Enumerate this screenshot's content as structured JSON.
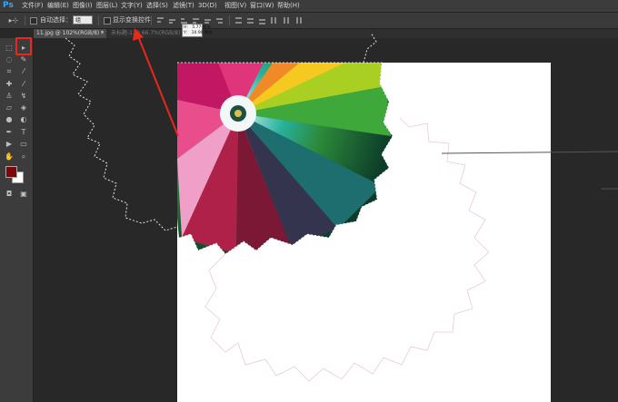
{
  "app": {
    "logo": "Ps"
  },
  "menubar": {
    "items": [
      "文件(F)",
      "编辑(E)",
      "图像(I)",
      "图层(L)",
      "文字(Y)",
      "选择(S)",
      "滤镜(T)",
      "3D(D)",
      "视图(V)",
      "窗口(W)",
      "帮助(H)"
    ]
  },
  "options": {
    "auto_select_label": "自动选择：",
    "auto_select_value": "组",
    "show_transform_label": "显示变换控件"
  },
  "tabs": {
    "active_label": "11.jpg @ 102%(RGB/8) *",
    "close_symbol": "×",
    "inactive_label": "未标题-1 @ 66.7%(RGB/8)"
  },
  "tooltip": {
    "w_line": "H：  5.77  厘米",
    "h_line": "Y：  10.90  厘米"
  },
  "toolbar": {
    "tools": [
      "move-tool",
      "marquee-tool",
      "lasso-tool",
      "quick-select-tool",
      "crop-tool",
      "eyedropper-tool",
      "spot-heal-tool",
      "brush-tool",
      "stamp-tool",
      "history-brush-tool",
      "eraser-tool",
      "gradient-tool",
      "blur-tool",
      "dodge-tool",
      "pen-tool",
      "type-tool",
      "path-select-tool",
      "shape-tool",
      "hand-tool",
      "zoom-tool"
    ],
    "foreground_color": "#7a0a0a",
    "background_color": "#ffffff"
  },
  "colors": {
    "highlight": "#e8281b",
    "canvas": "#ffffff",
    "workspace": "#282828"
  }
}
